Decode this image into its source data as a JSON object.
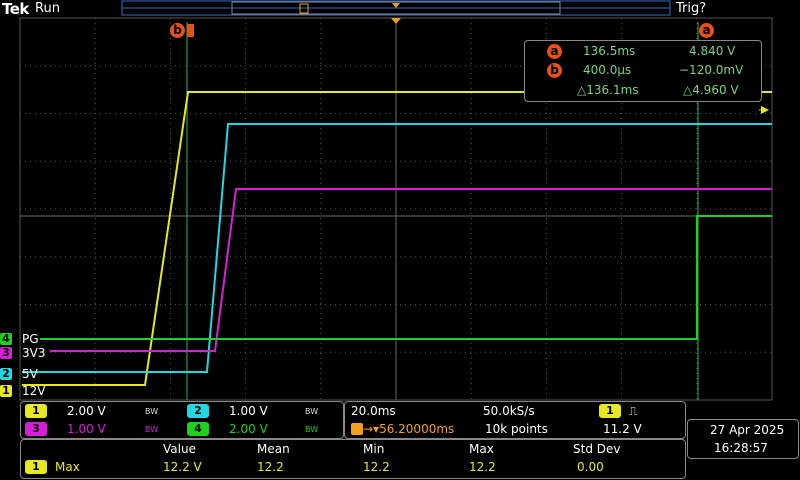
{
  "header": {
    "logo": "Tek",
    "run_state": "Run",
    "trigger_status": "Trig?"
  },
  "waveforms": {
    "channels": [
      {
        "id": "4",
        "label": "PG",
        "color": "#1fd01f"
      },
      {
        "id": "3",
        "label": "3V3",
        "color": "#d81fd8"
      },
      {
        "id": "2",
        "label": "5V",
        "color": "#1fd8e0"
      },
      {
        "id": "1",
        "label": "12V",
        "color": "#e8e81f"
      }
    ]
  },
  "cursors": {
    "a_label": "a",
    "b_label": "b",
    "a_time": "136.5ms",
    "a_value": "4.840 V",
    "b_time": "400.0µs",
    "b_value": "−120.0mV",
    "delta_time": "△136.1ms",
    "delta_value": "△4.960 V"
  },
  "vertical": {
    "ch1_id": "1",
    "ch1_scale": "2.00 V",
    "ch1_bw": "BW",
    "ch2_id": "2",
    "ch2_scale": "1.00 V",
    "ch2_bw": "BW",
    "ch3_id": "3",
    "ch3_scale": "1.00 V",
    "ch3_bw": "BW",
    "ch4_id": "4",
    "ch4_scale": "2.00 V",
    "ch4_bw": "BW"
  },
  "horizontal": {
    "timebase": "20.0ms",
    "sample_rate": "50.0kS/s",
    "trigger_position": "→▾56.20000ms",
    "record_length": "10k points",
    "trigger_source": "1",
    "trigger_slope": "⎍",
    "trigger_level": "11.2 V"
  },
  "datetime": {
    "date": "27 Apr  2025",
    "time": "16:28:57"
  },
  "measurements": {
    "headers": [
      "Value",
      "Mean",
      "Min",
      "Max",
      "Std Dev"
    ],
    "rows": [
      {
        "channel": "1",
        "type": "Max",
        "values": [
          "12.2 V",
          "12.2",
          "12.2",
          "12.2",
          "0.00"
        ]
      }
    ]
  },
  "colors": {
    "ch1": "#e8e81f",
    "ch2": "#1fd8e0",
    "ch3": "#d81fd8",
    "ch4": "#1fd01f",
    "cursor": "#e8501a",
    "trigger": "#f0a020"
  }
}
